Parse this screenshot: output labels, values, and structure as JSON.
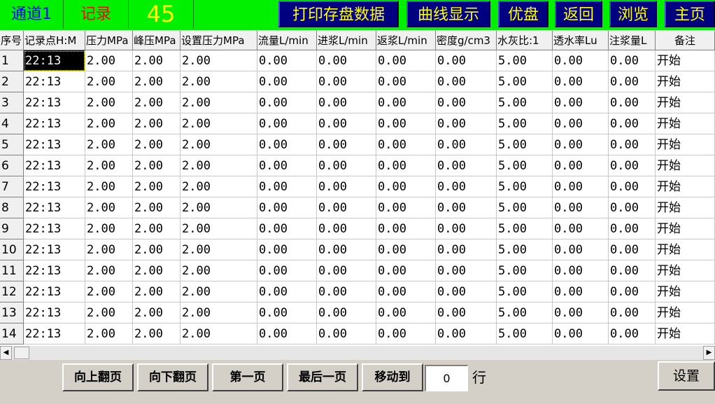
{
  "topbar": {
    "channel": "通道1",
    "record": "记录",
    "count": "45",
    "buttons": [
      {
        "label": "打印存盘数据"
      },
      {
        "label": "曲线显示"
      },
      {
        "label": "优盘"
      },
      {
        "label": "返回"
      },
      {
        "label": "浏览"
      },
      {
        "label": "主页"
      }
    ]
  },
  "table": {
    "headers": [
      "序号",
      "记录点H:M",
      "压力MPa",
      "峰压MPa",
      "设置压力MPa",
      "流量L/min",
      "进浆L/min",
      "返浆L/min",
      "密度g/cm3",
      "水灰比:1",
      "透水率Lu",
      "注浆量L",
      "备注"
    ],
    "rows": [
      [
        "1",
        "22:13",
        "2.00",
        "2.00",
        "2.00",
        "0.00",
        "0.00",
        "0.00",
        "0.00",
        "5.00",
        "0.00",
        "0.00",
        "开始"
      ],
      [
        "2",
        "22:13",
        "2.00",
        "2.00",
        "2.00",
        "0.00",
        "0.00",
        "0.00",
        "0.00",
        "5.00",
        "0.00",
        "0.00",
        "开始"
      ],
      [
        "3",
        "22:13",
        "2.00",
        "2.00",
        "2.00",
        "0.00",
        "0.00",
        "0.00",
        "0.00",
        "5.00",
        "0.00",
        "0.00",
        "开始"
      ],
      [
        "4",
        "22:13",
        "2.00",
        "2.00",
        "2.00",
        "0.00",
        "0.00",
        "0.00",
        "0.00",
        "5.00",
        "0.00",
        "0.00",
        "开始"
      ],
      [
        "5",
        "22:13",
        "2.00",
        "2.00",
        "2.00",
        "0.00",
        "0.00",
        "0.00",
        "0.00",
        "5.00",
        "0.00",
        "0.00",
        "开始"
      ],
      [
        "6",
        "22:13",
        "2.00",
        "2.00",
        "2.00",
        "0.00",
        "0.00",
        "0.00",
        "0.00",
        "5.00",
        "0.00",
        "0.00",
        "开始"
      ],
      [
        "7",
        "22:13",
        "2.00",
        "2.00",
        "2.00",
        "0.00",
        "0.00",
        "0.00",
        "0.00",
        "5.00",
        "0.00",
        "0.00",
        "开始"
      ],
      [
        "8",
        "22:13",
        "2.00",
        "2.00",
        "2.00",
        "0.00",
        "0.00",
        "0.00",
        "0.00",
        "5.00",
        "0.00",
        "0.00",
        "开始"
      ],
      [
        "9",
        "22:13",
        "2.00",
        "2.00",
        "2.00",
        "0.00",
        "0.00",
        "0.00",
        "0.00",
        "5.00",
        "0.00",
        "0.00",
        "开始"
      ],
      [
        "10",
        "22:13",
        "2.00",
        "2.00",
        "2.00",
        "0.00",
        "0.00",
        "0.00",
        "0.00",
        "5.00",
        "0.00",
        "0.00",
        "开始"
      ],
      [
        "11",
        "22:13",
        "2.00",
        "2.00",
        "2.00",
        "0.00",
        "0.00",
        "0.00",
        "0.00",
        "5.00",
        "0.00",
        "0.00",
        "开始"
      ],
      [
        "12",
        "22:13",
        "2.00",
        "2.00",
        "2.00",
        "0.00",
        "0.00",
        "0.00",
        "0.00",
        "5.00",
        "0.00",
        "0.00",
        "开始"
      ],
      [
        "13",
        "22:13",
        "2.00",
        "2.00",
        "2.00",
        "0.00",
        "0.00",
        "0.00",
        "0.00",
        "5.00",
        "0.00",
        "0.00",
        "开始"
      ],
      [
        "14",
        "22:13",
        "2.00",
        "2.00",
        "2.00",
        "0.00",
        "0.00",
        "0.00",
        "0.00",
        "5.00",
        "0.00",
        "0.00",
        "开始"
      ]
    ]
  },
  "scrollbar": {
    "left_icon": "scroll-left-icon",
    "right_icon": "scroll-right-icon"
  },
  "footer": {
    "prev_page": "向上翻页",
    "next_page": "向下翻页",
    "first_page": "第一页",
    "last_page": "最后一页",
    "move_to": "移动到",
    "row_input": "0",
    "row_label": "行",
    "settings": "设置"
  },
  "colors": {
    "topbar_bg": "#00f000",
    "button_bg": "#000080",
    "button_text": "#ffff00",
    "channel_text": "#0000ff",
    "record_text": "#ff0000",
    "count_text": "#ffff00"
  }
}
